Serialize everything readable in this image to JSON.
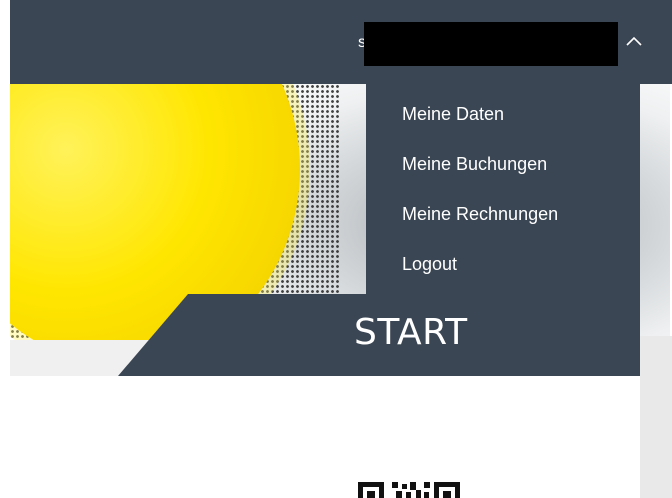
{
  "header": {
    "user_initial": "s",
    "user_name_redacted": true
  },
  "user_menu": {
    "items": [
      {
        "label": "Meine Daten"
      },
      {
        "label": "Meine Buchungen"
      },
      {
        "label": "Meine Rechnungen"
      },
      {
        "label": "Logout"
      }
    ]
  },
  "hero": {
    "start_label": "START"
  },
  "colors": {
    "header_bg": "#3b4654",
    "menu_bg": "#3b4654",
    "menu_text": "#ffffff",
    "ball_yellow": "#ffe600"
  },
  "icons": {
    "toggle": "chevron-up-icon"
  }
}
